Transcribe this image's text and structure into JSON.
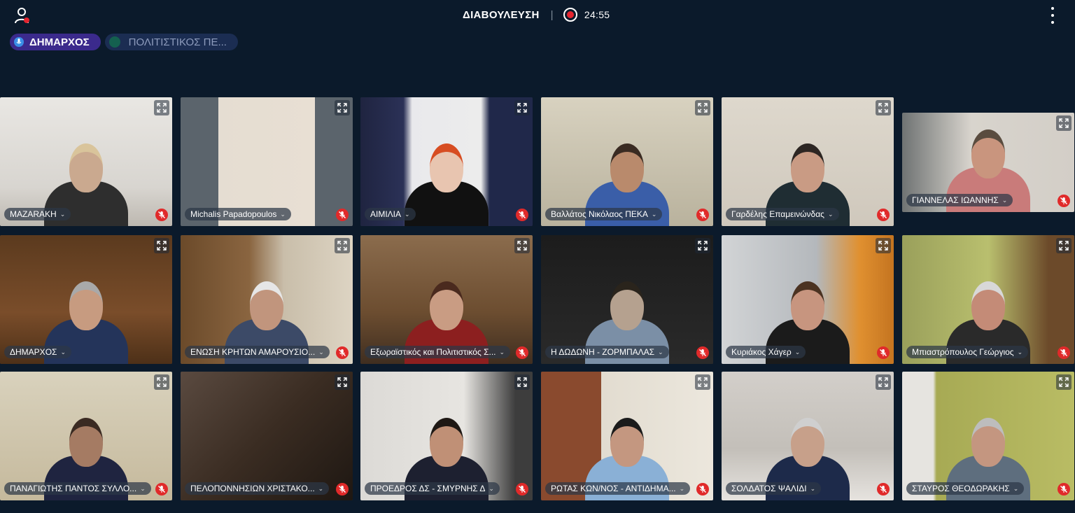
{
  "header": {
    "title": "ΔΙΑΒΟΥΛΕΥΣΗ",
    "timer": "24:55",
    "recording_color": "#e4242e",
    "user_icon": "user-icon",
    "more_icon": "more-vertical-icon"
  },
  "speakers": [
    {
      "label": "ΔΗΜΑΡΧΟΣ",
      "active": true
    },
    {
      "label": "ΠΟΛΙΤΙΣΤΙΚΟΣ ΠΕ...",
      "active": false
    }
  ],
  "participants": [
    {
      "name": "ΜΑΖΑRΑΚΗ",
      "muted": true
    },
    {
      "name": "Michalis Papadopoulos",
      "muted": true
    },
    {
      "name": "ΑΙΜΙΛΙΑ",
      "muted": true
    },
    {
      "name": "Βαλλάτος Νικόλαος ΠΕΚΑ",
      "muted": true
    },
    {
      "name": "Γαρδέλης Επαμεινώνδας",
      "muted": true
    },
    {
      "name": "ΓΙΑΝΝΕΛΑΣ ΙΩΑΝΝΗΣ",
      "muted": true
    },
    {
      "name": "ΔΗΜΑΡΧΟΣ",
      "muted": false
    },
    {
      "name": "ΕΝΩΣΗ ΚΡΗΤΩΝ ΑΜΑΡΟΥΣΙΟ...",
      "muted": true
    },
    {
      "name": "Εξωραϊστικός και Πολιτιστικός Σ...",
      "muted": true
    },
    {
      "name": "Η ΔΩΔΩΝΗ - ΖΟΡΜΠΑΛΑΣ",
      "muted": true
    },
    {
      "name": "Κυριάκος Χάγερ",
      "muted": true
    },
    {
      "name": "Μπιαστρόπουλος Γεώργιος",
      "muted": true
    },
    {
      "name": "ΠΑΝΑΓΙΩΤΗΣ ΠΑΝΤΟΣ ΣΥΛΛΟ...",
      "muted": true
    },
    {
      "name": "ΠΕΛΟΠΟΝΝΗΣΙΩΝ ΧΡΙΣΤΑΚΟ...",
      "muted": true
    },
    {
      "name": "ΠΡΟΕΔΡΟΣ ΔΣ - ΣΜΥΡΝΗΣ Δ",
      "muted": true
    },
    {
      "name": "ΡΩΤΑΣ ΚΩΝ/ΝΟΣ - ΑΝΤΙΔΗΜΑ...",
      "muted": true
    },
    {
      "name": "ΣΟΛΔΑΤΟΣ ΨΑΛΙΔΙ",
      "muted": true
    },
    {
      "name": "ΣΤΑΥΡΟΣ ΘΕΟΔΩΡΑΚΗΣ",
      "muted": true
    }
  ],
  "icons": {
    "expand": "expand-icon",
    "mic_off": "mic-off-icon",
    "mic": "mic-icon",
    "chevron": "chevron-down-icon"
  }
}
